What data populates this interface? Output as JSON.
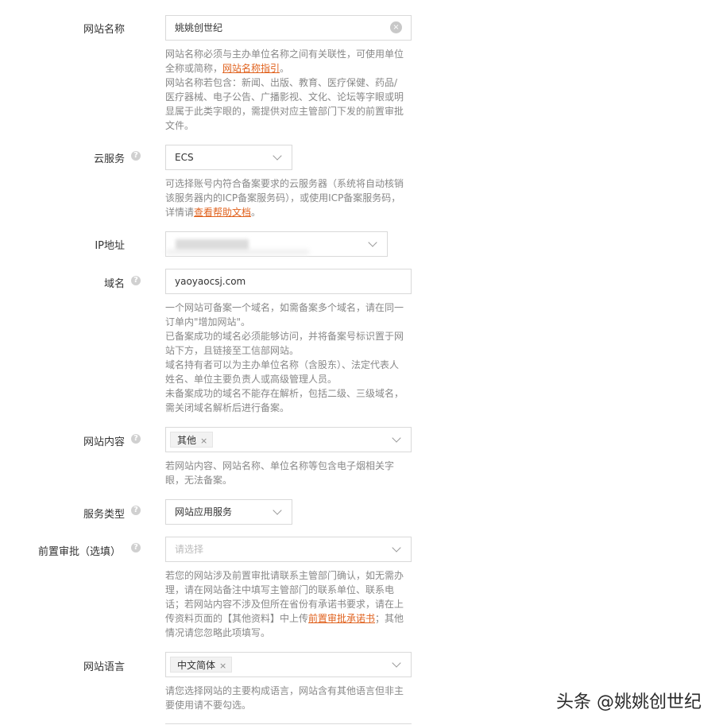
{
  "site_name": {
    "label": "网站名称",
    "value": "姚姚创世纪",
    "hint_part1": "网站名称必须与主办单位名称之间有关联性，可使用单位全称或简称，",
    "hint_link": "网站名称指引",
    "hint_part2": "。",
    "hint_p2": "网站名称若包含：新闻、出版、教育、医疗保健、药品/医疗器械、电子公告、广播影视、文化、论坛等字眼或明显属于此类字眼的，需提供对应主管部门下发的前置审批文件。"
  },
  "cloud_service": {
    "label": "云服务",
    "value": "ECS",
    "hint_part1": "可选择账号内符合备案要求的云服务器（系统将自动核销该服务器内的ICP备案服务码），或使用ICP备案服务码，详情请",
    "hint_link": "查看帮助文档",
    "hint_part2": "。"
  },
  "ip_address": {
    "label": "IP地址"
  },
  "domain": {
    "label": "域名",
    "value": "yaoyaocsj.com",
    "hints": [
      "一个网站可备案一个域名，如需备案多个域名，请在同一订单内\"增加网站\"。",
      "已备案成功的域名必须能够访问，并将备案号标识置于网站下方，且链接至工信部网站。",
      "域名持有者可以为主办单位名称（含股东）、法定代表人姓名、单位主要负责人或高级管理人员。",
      "未备案成功的域名不能存在解析，包括二级、三级域名，需关闭域名解析后进行备案。"
    ]
  },
  "site_content": {
    "label": "网站内容",
    "tag": "其他",
    "hint": "若网站内容、网站名称、单位名称等包含电子烟相关字眼，无法备案。"
  },
  "service_type": {
    "label": "服务类型",
    "value": "网站应用服务"
  },
  "pre_approval": {
    "label": "前置审批（选填）",
    "placeholder": "请选择",
    "hint_part1": "若您的网站涉及前置审批请联系主管部门确认，如无需办理，请在网站备注中填写主管部门的联系单位、联系电话；若网站内容不涉及但所在省份有承诺书要求，请在上传资料页面的【其他资料】中上传",
    "hint_link": "前置审批承诺书",
    "hint_part2": "；其他情况请您忽略此项填写。"
  },
  "site_language": {
    "label": "网站语言",
    "tag": "中文简体",
    "hint": "请您选择网站的主要构成语言，网站含有其他语言但非主要使用请不要勾选。"
  },
  "icons": {
    "help": "?",
    "close": "×"
  },
  "watermark": "头条 @姚姚创世纪"
}
